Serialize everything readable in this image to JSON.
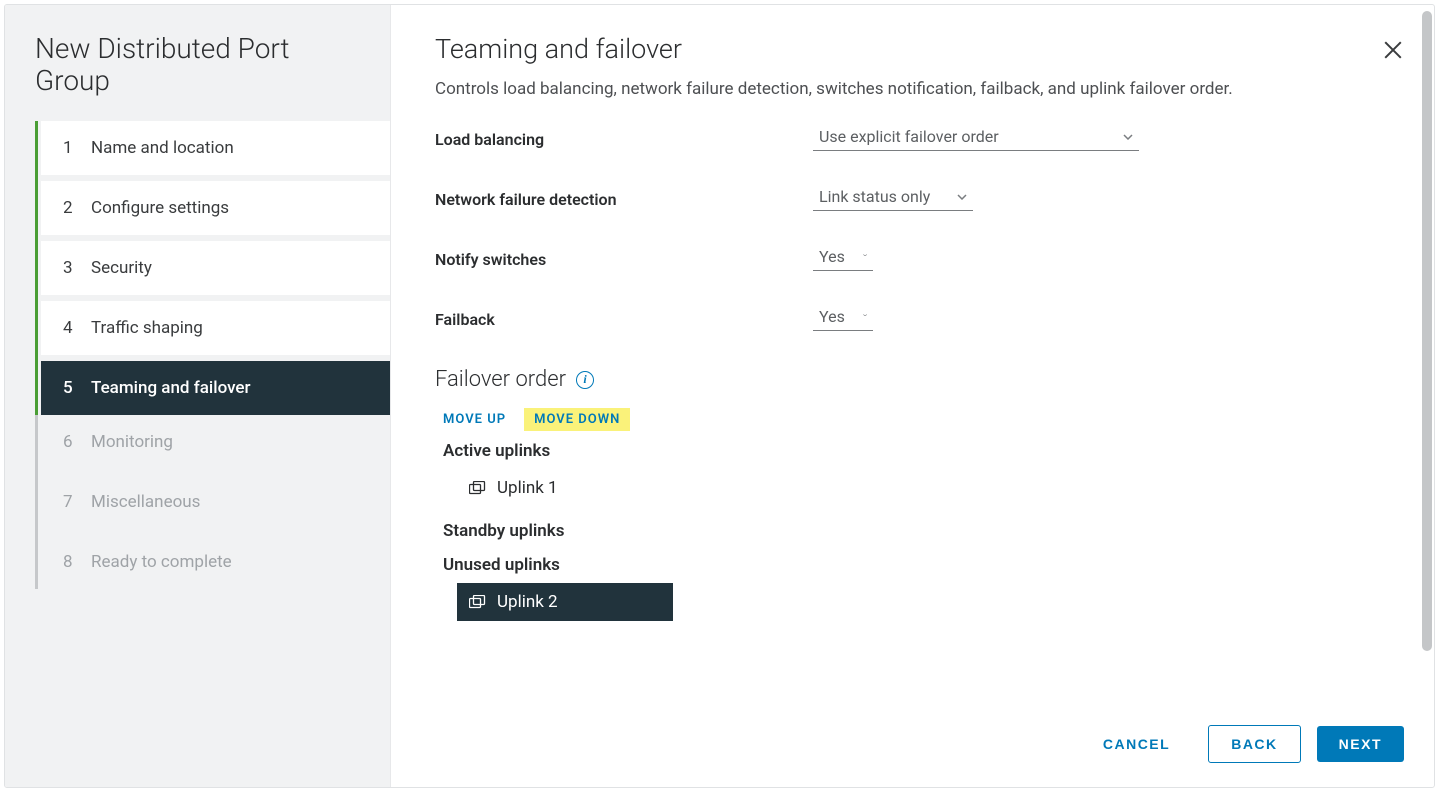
{
  "wizard_title": "New Distributed Port Group",
  "steps": [
    {
      "num": "1",
      "label": "Name and location",
      "state": "completed"
    },
    {
      "num": "2",
      "label": "Configure settings",
      "state": "completed"
    },
    {
      "num": "3",
      "label": "Security",
      "state": "completed"
    },
    {
      "num": "4",
      "label": "Traffic shaping",
      "state": "completed"
    },
    {
      "num": "5",
      "label": "Teaming and failover",
      "state": "active"
    },
    {
      "num": "6",
      "label": "Monitoring",
      "state": "future"
    },
    {
      "num": "7",
      "label": "Miscellaneous",
      "state": "future"
    },
    {
      "num": "8",
      "label": "Ready to complete",
      "state": "future"
    }
  ],
  "panel": {
    "title": "Teaming and failover",
    "description": "Controls load balancing, network failure detection, switches notification, failback, and uplink failover order."
  },
  "form": {
    "load_balancing": {
      "label": "Load balancing",
      "value": "Use explicit failover order"
    },
    "network_failure_detection": {
      "label": "Network failure detection",
      "value": "Link status only"
    },
    "notify_switches": {
      "label": "Notify switches",
      "value": "Yes"
    },
    "failback": {
      "label": "Failback",
      "value": "Yes"
    }
  },
  "failover": {
    "heading": "Failover order",
    "move_up": "MOVE UP",
    "move_down": "MOVE DOWN",
    "groups": {
      "active": {
        "label": "Active uplinks",
        "items": [
          "Uplink 1"
        ]
      },
      "standby": {
        "label": "Standby uplinks",
        "items": []
      },
      "unused": {
        "label": "Unused uplinks",
        "items": [
          "Uplink 2"
        ]
      }
    },
    "selected": "Uplink 2"
  },
  "buttons": {
    "cancel": "CANCEL",
    "back": "BACK",
    "next": "NEXT"
  }
}
